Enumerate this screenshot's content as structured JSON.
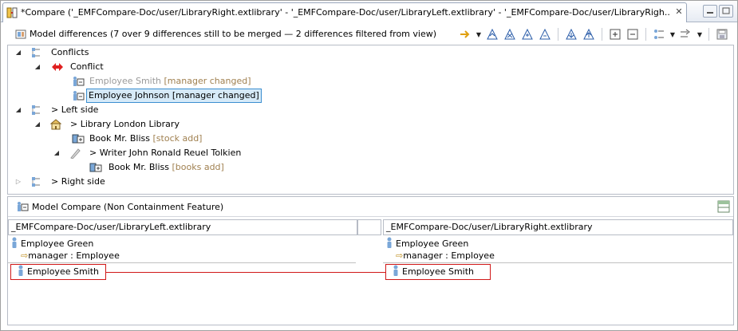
{
  "tab": {
    "title": "*Compare ('_EMFCompare-Doc/user/LibraryRight.extlibrary' - '_EMFCompare-Doc/user/LibraryLeft.extlibrary' - '_EMFCompare-Doc/user/LibraryRigh...",
    "close": "✕"
  },
  "toolbar": {
    "label": "Model differences  (7 over 9 differences still to be merged — 2 differences filtered from view)"
  },
  "tree": {
    "conflicts": "Conflicts",
    "conflict": "Conflict",
    "smith_name": "Employee Smith",
    "smith_tag": "[manager changed]",
    "johnson": "Employee Johnson [manager changed]",
    "left_side_prefix": ">",
    "left_side": "Left side",
    "library_prefix": ">",
    "library": "Library London Library",
    "bliss_name": "Book Mr. Bliss",
    "bliss_tag": "[stock add]",
    "writer_prefix": ">",
    "writer": "Writer John Ronald Reuel Tolkien",
    "bliss2_name": "Book Mr. Bliss",
    "bliss2_tag": "[books add]",
    "right_side_prefix": ">",
    "right_side": "Right side"
  },
  "lower": {
    "title": "Model Compare (Non Containment Feature)",
    "left_path": "_EMFCompare-Doc/user/LibraryLeft.extlibrary",
    "right_path": "_EMFCompare-Doc/user/LibraryRight.extlibrary",
    "left_green": "Employee Green",
    "left_manager": "manager : Employee",
    "right_green": "Employee Green",
    "right_manager": "manager : Employee",
    "left_smith": "Employee Smith",
    "right_smith": "Employee Smith"
  },
  "colors": {
    "selection": "#d6eaf8",
    "conflict_red": "#d01818",
    "tag_brown": "#a08050"
  }
}
